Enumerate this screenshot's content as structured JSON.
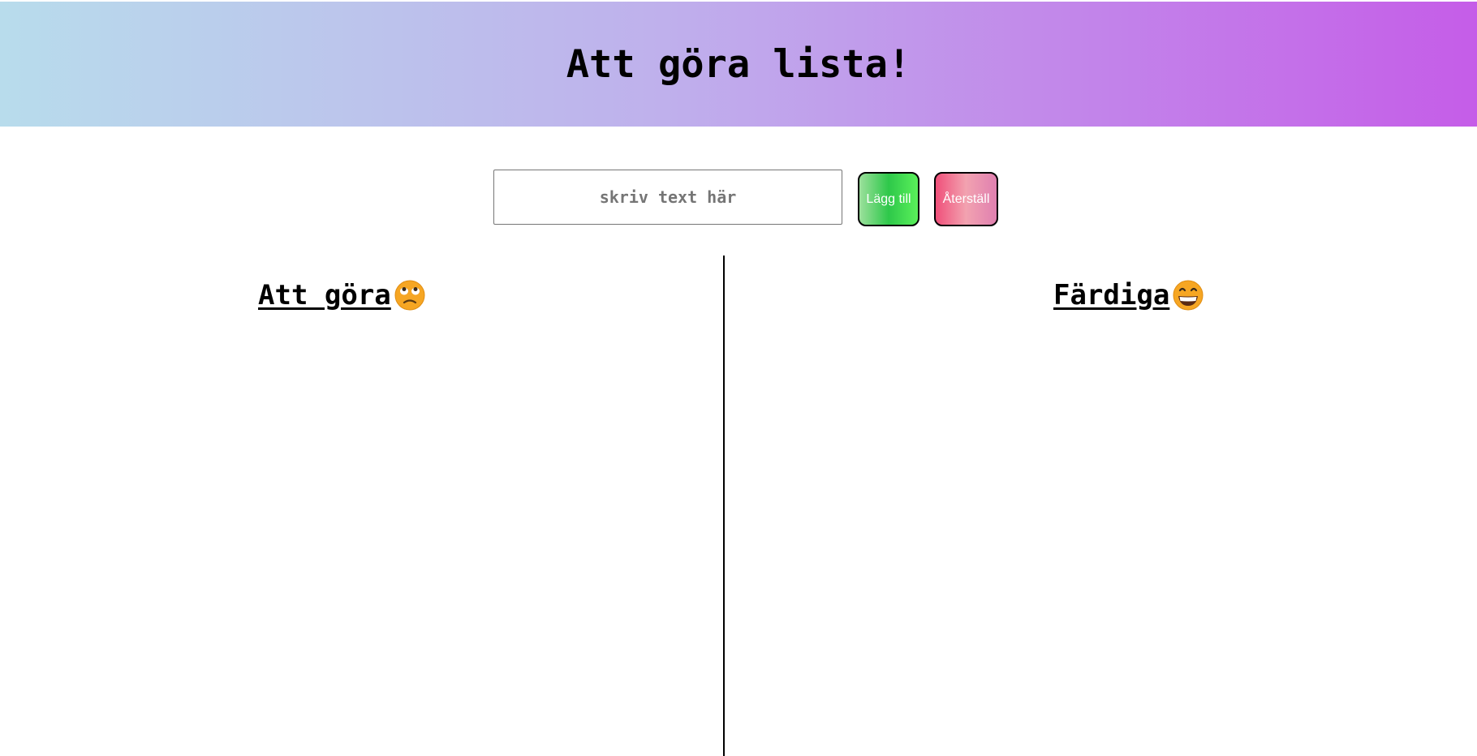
{
  "header": {
    "title": "Att göra lista!"
  },
  "form": {
    "input_value": "",
    "input_placeholder": "skriv text här",
    "add_label": "Lägg till",
    "reset_label": "Återställ"
  },
  "columns": {
    "todo": {
      "title": "Att göra",
      "icon": "rolling-eyes-face-icon",
      "items": []
    },
    "done": {
      "title": "Färdiga",
      "icon": "grinning-face-icon",
      "items": []
    }
  },
  "colors": {
    "header_gradient_start": "#b8dcec",
    "header_gradient_end": "#c55de8",
    "add_button": "#2ec84a",
    "reset_button": "#f0507a"
  }
}
